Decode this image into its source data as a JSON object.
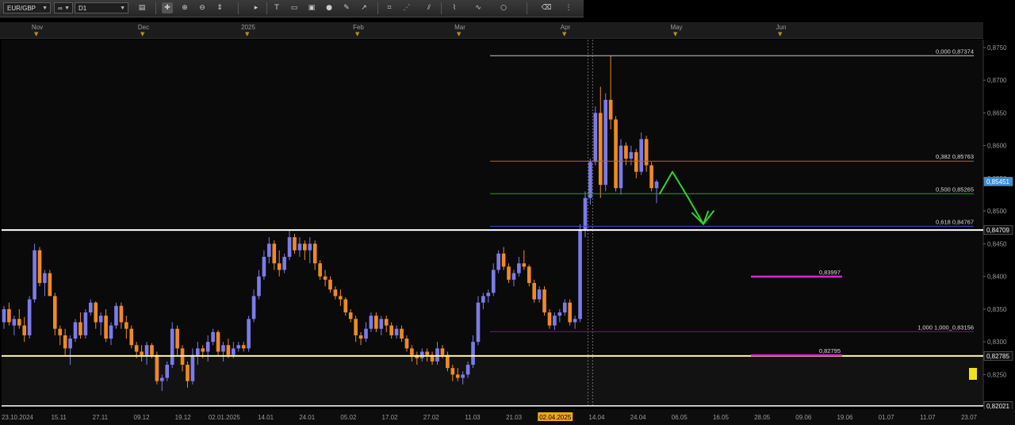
{
  "toolbar": {
    "symbol": "EUR/GBP",
    "timeframe": "D1",
    "icons": [
      "chart-type-icon",
      "crosshair-icon",
      "zoom-in-icon",
      "zoom-out-icon",
      "scroll-icon",
      "cursor-icon",
      "text-tool-icon",
      "note-icon",
      "image-icon",
      "globe-icon",
      "pencil-icon",
      "arrow-tool-icon",
      "screenshot-icon",
      "trend-icon",
      "channel-icon",
      "fibonacci-icon",
      "indicator-icon",
      "shape-icon",
      "eraser-icon",
      "more-icon"
    ]
  },
  "colors": {
    "background": "#000000",
    "bull_candle": "#7b7bea",
    "bear_candle": "#ef8a22",
    "fib_0": "#c8c8c8",
    "fib_382": "#b8652a",
    "fib_500": "#1fa32b",
    "fib_618": "#3b4bd6",
    "fib_1000": "#6a1f6a",
    "resistance": "#ffffff",
    "support": "#fff6a0",
    "target": "#e020d8",
    "arrow": "#2dd62d",
    "price_label": "#3a8fd8"
  },
  "chart_data": {
    "type": "candlestick",
    "symbol": "EUR/GBP",
    "timeframe": "D1",
    "ylim": [
      0.8202,
      0.8762
    ],
    "y_ticks": [
      "0,8750",
      "0,8700",
      "0,8650",
      "0,8600",
      "0,8550",
      "0,8500",
      "0,8450",
      "0,8400",
      "0,8350",
      "0,8300",
      "0,8250"
    ],
    "y_tick_values": [
      0.875,
      0.87,
      0.865,
      0.86,
      0.855,
      0.85,
      0.845,
      0.84,
      0.835,
      0.83,
      0.825
    ],
    "x_labels": [
      "23.10.2024",
      "15.11",
      "27.11",
      "09.12",
      "19.12",
      "02.01.2025",
      "14.01",
      "24.01",
      "05.02",
      "17.02",
      "27.02",
      "11.03",
      "21.03",
      "02.04.2025",
      "14.04",
      "24.04",
      "06.05",
      "16.05",
      "28.05",
      "09.06",
      "19.06",
      "01.07",
      "11.07",
      "23.07"
    ],
    "highlighted_x_label": "02.04.2025",
    "month_labels": [
      "Nov",
      "Dec",
      "2025",
      "Feb",
      "Mar",
      "Apr",
      "May",
      "Jun"
    ],
    "current_price": {
      "value": 0.85451,
      "label": "0,85451"
    },
    "fibonacci": [
      {
        "level": "0,000",
        "price": 0.87374,
        "price_label": "0,87374"
      },
      {
        "level": "0,382",
        "price": 0.85763,
        "price_label": "0,85763"
      },
      {
        "level": "0,500",
        "price": 0.85265,
        "price_label": "0,85265"
      },
      {
        "level": "0,618",
        "price": 0.84767,
        "price_label": "0,84767"
      },
      {
        "level": "1,000",
        "price": 0.83156,
        "price_label": "1,000_0,83156"
      }
    ],
    "horizontal_lines": [
      {
        "kind": "resistance",
        "price": 0.84709,
        "label": "0,84709"
      },
      {
        "kind": "support",
        "price": 0.82785,
        "label": "0,82785"
      },
      {
        "kind": "bottom",
        "price": 0.82021,
        "label": "0,82021"
      }
    ],
    "targets": [
      {
        "price": 0.83997,
        "label": "0,83997"
      },
      {
        "price": 0.82795,
        "label": "0,82795"
      }
    ],
    "candles": [
      [
        0.833,
        0.8355,
        0.832,
        0.835
      ],
      [
        0.835,
        0.836,
        0.8325,
        0.833
      ],
      [
        0.8325,
        0.834,
        0.831,
        0.8335
      ],
      [
        0.8335,
        0.835,
        0.832,
        0.8325
      ],
      [
        0.8325,
        0.8338,
        0.83,
        0.831
      ],
      [
        0.831,
        0.837,
        0.8305,
        0.8365
      ],
      [
        0.8365,
        0.845,
        0.836,
        0.844
      ],
      [
        0.844,
        0.8445,
        0.8385,
        0.839
      ],
      [
        0.839,
        0.841,
        0.837,
        0.8405
      ],
      [
        0.8405,
        0.841,
        0.838,
        0.837
      ],
      [
        0.837,
        0.8375,
        0.831,
        0.832
      ],
      [
        0.832,
        0.8325,
        0.8295,
        0.831
      ],
      [
        0.831,
        0.832,
        0.828,
        0.829
      ],
      [
        0.829,
        0.831,
        0.8265,
        0.8305
      ],
      [
        0.8305,
        0.8335,
        0.83,
        0.833
      ],
      [
        0.833,
        0.8345,
        0.8305,
        0.831
      ],
      [
        0.831,
        0.835,
        0.8305,
        0.8345
      ],
      [
        0.8345,
        0.8365,
        0.834,
        0.836
      ],
      [
        0.836,
        0.8362,
        0.832,
        0.833
      ],
      [
        0.833,
        0.8345,
        0.831,
        0.834
      ],
      [
        0.834,
        0.835,
        0.83,
        0.8305
      ],
      [
        0.8305,
        0.833,
        0.8295,
        0.8325
      ],
      [
        0.8325,
        0.836,
        0.832,
        0.8355
      ],
      [
        0.8355,
        0.836,
        0.832,
        0.833
      ],
      [
        0.833,
        0.834,
        0.8305,
        0.832
      ],
      [
        0.832,
        0.8325,
        0.829,
        0.8295
      ],
      [
        0.8295,
        0.83,
        0.8275,
        0.8285
      ],
      [
        0.8285,
        0.8295,
        0.827,
        0.828
      ],
      [
        0.828,
        0.83,
        0.8265,
        0.8295
      ],
      [
        0.8295,
        0.8298,
        0.8275,
        0.828
      ],
      [
        0.828,
        0.8285,
        0.8235,
        0.824
      ],
      [
        0.824,
        0.825,
        0.8225,
        0.8245
      ],
      [
        0.8245,
        0.827,
        0.824,
        0.8265
      ],
      [
        0.8265,
        0.833,
        0.826,
        0.832
      ],
      [
        0.832,
        0.8325,
        0.828,
        0.829
      ],
      [
        0.829,
        0.8295,
        0.8255,
        0.8265
      ],
      [
        0.8265,
        0.827,
        0.823,
        0.824
      ],
      [
        0.824,
        0.829,
        0.8235,
        0.828
      ],
      [
        0.828,
        0.83,
        0.8265,
        0.829
      ],
      [
        0.829,
        0.8295,
        0.8275,
        0.8285
      ],
      [
        0.8285,
        0.831,
        0.827,
        0.83
      ],
      [
        0.83,
        0.832,
        0.8295,
        0.8315
      ],
      [
        0.8315,
        0.8318,
        0.828,
        0.8285
      ],
      [
        0.8285,
        0.83,
        0.827,
        0.8295
      ],
      [
        0.8295,
        0.8305,
        0.8275,
        0.828
      ],
      [
        0.828,
        0.83,
        0.8275,
        0.829
      ],
      [
        0.829,
        0.83,
        0.8285,
        0.8295
      ],
      [
        0.8295,
        0.83,
        0.8285,
        0.829
      ],
      [
        0.829,
        0.834,
        0.8285,
        0.8335
      ],
      [
        0.8335,
        0.838,
        0.833,
        0.837
      ],
      [
        0.837,
        0.841,
        0.8365,
        0.84
      ],
      [
        0.84,
        0.844,
        0.8395,
        0.843
      ],
      [
        0.843,
        0.846,
        0.842,
        0.845
      ],
      [
        0.845,
        0.8455,
        0.841,
        0.842
      ],
      [
        0.842,
        0.844,
        0.84,
        0.841
      ],
      [
        0.841,
        0.8435,
        0.8405,
        0.843
      ],
      [
        0.843,
        0.847,
        0.8425,
        0.846
      ],
      [
        0.846,
        0.8465,
        0.8435,
        0.844
      ],
      [
        0.844,
        0.846,
        0.843,
        0.845
      ],
      [
        0.845,
        0.8455,
        0.8425,
        0.844
      ],
      [
        0.844,
        0.846,
        0.842,
        0.845
      ],
      [
        0.845,
        0.8455,
        0.841,
        0.842
      ],
      [
        0.842,
        0.8425,
        0.8395,
        0.84
      ],
      [
        0.84,
        0.841,
        0.8385,
        0.8395
      ],
      [
        0.8395,
        0.84,
        0.8375,
        0.838
      ],
      [
        0.838,
        0.8385,
        0.8365,
        0.837
      ],
      [
        0.837,
        0.838,
        0.8355,
        0.8365
      ],
      [
        0.8365,
        0.8368,
        0.834,
        0.8345
      ],
      [
        0.8345,
        0.835,
        0.833,
        0.8335
      ],
      [
        0.8335,
        0.834,
        0.83,
        0.831
      ],
      [
        0.831,
        0.8315,
        0.8295,
        0.8305
      ],
      [
        0.8305,
        0.833,
        0.83,
        0.832
      ],
      [
        0.832,
        0.8345,
        0.8315,
        0.834
      ],
      [
        0.834,
        0.8345,
        0.8315,
        0.832
      ],
      [
        0.832,
        0.834,
        0.831,
        0.8335
      ],
      [
        0.8335,
        0.834,
        0.8315,
        0.8325
      ],
      [
        0.8325,
        0.833,
        0.8305,
        0.831
      ],
      [
        0.831,
        0.8325,
        0.8305,
        0.832
      ],
      [
        0.832,
        0.8325,
        0.83,
        0.8305
      ],
      [
        0.8305,
        0.831,
        0.8285,
        0.829
      ],
      [
        0.829,
        0.8295,
        0.827,
        0.828
      ],
      [
        0.828,
        0.8285,
        0.8265,
        0.8275
      ],
      [
        0.8275,
        0.829,
        0.827,
        0.8285
      ],
      [
        0.8285,
        0.829,
        0.827,
        0.828
      ],
      [
        0.828,
        0.8285,
        0.8265,
        0.827
      ],
      [
        0.827,
        0.83,
        0.8265,
        0.829
      ],
      [
        0.829,
        0.8295,
        0.8275,
        0.828
      ],
      [
        0.828,
        0.8285,
        0.8255,
        0.826
      ],
      [
        0.826,
        0.8265,
        0.824,
        0.825
      ],
      [
        0.825,
        0.826,
        0.824,
        0.8245
      ],
      [
        0.8245,
        0.8255,
        0.8235,
        0.825
      ],
      [
        0.825,
        0.827,
        0.8245,
        0.8265
      ],
      [
        0.8265,
        0.831,
        0.826,
        0.83
      ],
      [
        0.83,
        0.837,
        0.8295,
        0.836
      ],
      [
        0.836,
        0.8375,
        0.835,
        0.837
      ],
      [
        0.837,
        0.838,
        0.836,
        0.8375
      ],
      [
        0.8375,
        0.842,
        0.837,
        0.841
      ],
      [
        0.841,
        0.844,
        0.8405,
        0.8435
      ],
      [
        0.8435,
        0.8445,
        0.841,
        0.8415
      ],
      [
        0.8415,
        0.842,
        0.839,
        0.8395
      ],
      [
        0.8395,
        0.841,
        0.8385,
        0.8405
      ],
      [
        0.8405,
        0.843,
        0.84,
        0.842
      ],
      [
        0.842,
        0.844,
        0.841,
        0.8415
      ],
      [
        0.8415,
        0.8418,
        0.8385,
        0.839
      ],
      [
        0.839,
        0.8395,
        0.836,
        0.8365
      ],
      [
        0.8365,
        0.8385,
        0.836,
        0.838
      ],
      [
        0.838,
        0.8385,
        0.834,
        0.8345
      ],
      [
        0.8345,
        0.835,
        0.832,
        0.8325
      ],
      [
        0.8325,
        0.8345,
        0.8318,
        0.834
      ],
      [
        0.834,
        0.835,
        0.833,
        0.8345
      ],
      [
        0.8345,
        0.8365,
        0.834,
        0.836
      ],
      [
        0.836,
        0.8365,
        0.8325,
        0.833
      ],
      [
        0.833,
        0.834,
        0.832,
        0.8335
      ],
      [
        0.8335,
        0.848,
        0.833,
        0.847
      ],
      [
        0.847,
        0.853,
        0.846,
        0.852
      ],
      [
        0.852,
        0.858,
        0.851,
        0.8575
      ],
      [
        0.8575,
        0.866,
        0.857,
        0.865
      ],
      [
        0.865,
        0.869,
        0.852,
        0.854
      ],
      [
        0.854,
        0.868,
        0.853,
        0.867
      ],
      [
        0.867,
        0.8737,
        0.8625,
        0.864
      ],
      [
        0.864,
        0.8645,
        0.853,
        0.8535
      ],
      [
        0.8535,
        0.861,
        0.8525,
        0.86
      ],
      [
        0.86,
        0.8605,
        0.857,
        0.858
      ],
      [
        0.858,
        0.86,
        0.857,
        0.859
      ],
      [
        0.859,
        0.8595,
        0.855,
        0.856
      ],
      [
        0.856,
        0.862,
        0.8555,
        0.861
      ],
      [
        0.861,
        0.8615,
        0.856,
        0.857
      ],
      [
        0.857,
        0.8575,
        0.853,
        0.8535
      ],
      [
        0.8535,
        0.8548,
        0.8512,
        0.8545
      ]
    ],
    "projected_path": [
      [
        0.85265,
        0
      ],
      [
        0.856,
        1
      ],
      [
        0.852,
        2
      ],
      [
        0.848,
        3
      ],
      [
        0.85,
        4
      ]
    ]
  }
}
